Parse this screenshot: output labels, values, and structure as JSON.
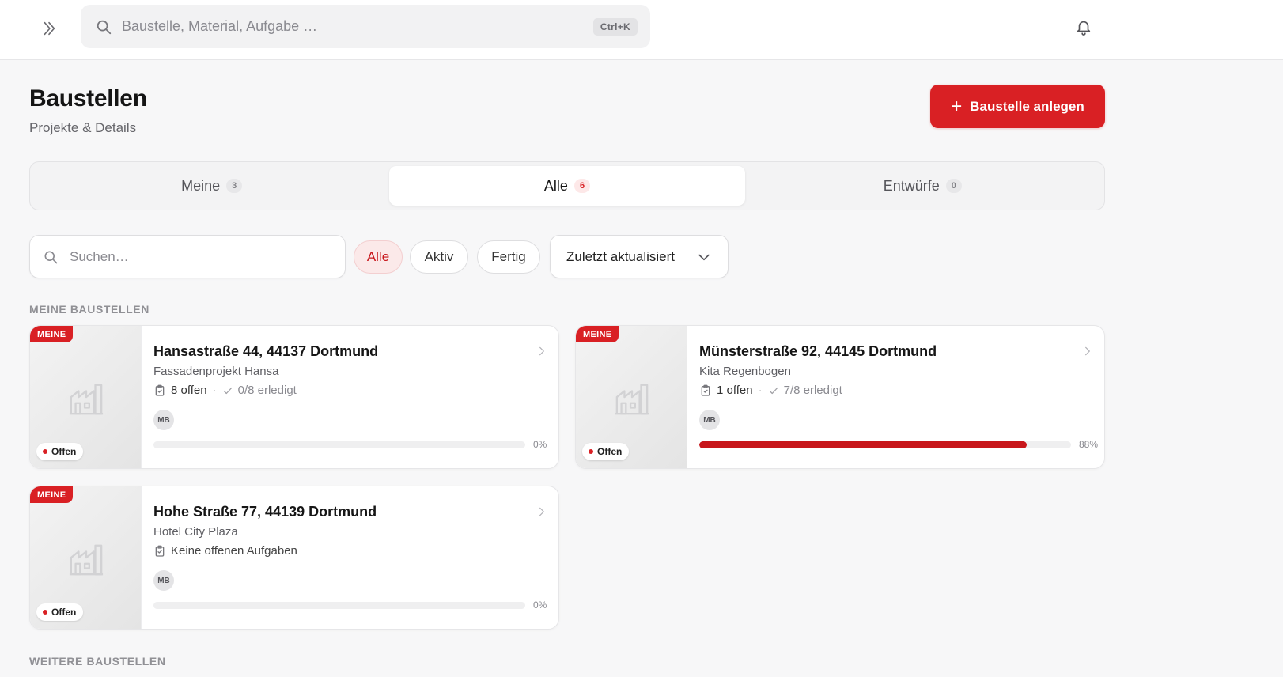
{
  "topbar": {
    "search_placeholder": "Baustelle, Material, Aufgabe …",
    "search_shortcut": "Ctrl+K"
  },
  "header": {
    "title": "Baustellen",
    "subtitle": "Projekte & Details",
    "create_button_label": "Baustelle anlegen"
  },
  "tabs": [
    {
      "label": "Meine",
      "count": "3",
      "active": false
    },
    {
      "label": "Alle",
      "count": "6",
      "active": true
    },
    {
      "label": "Entwürfe",
      "count": "0",
      "active": false
    }
  ],
  "filters": {
    "search_placeholder": "Suchen…",
    "chips": [
      {
        "label": "Alle",
        "active": true
      },
      {
        "label": "Aktiv",
        "active": false
      },
      {
        "label": "Fertig",
        "active": false
      }
    ],
    "sort_value": "Zuletzt aktualisiert"
  },
  "sections": {
    "mine_label": "MEINE BAUSTELLEN",
    "more_label": "WEITERE BAUSTELLEN"
  },
  "cards": [
    {
      "tag": "MEINE",
      "status": "Offen",
      "title": "Hansastraße 44, 44137 Dortmund",
      "project": "Fassadenprojekt Hansa",
      "open_tasks": "8 offen",
      "done_tasks": "0/8 erledigt",
      "avatar": "MB",
      "progress": 0,
      "progress_label": "0%"
    },
    {
      "tag": "MEINE",
      "status": "Offen",
      "title": "Münsterstraße 92, 44145 Dortmund",
      "project": "Kita Regenbogen",
      "open_tasks": "1 offen",
      "done_tasks": "7/8 erledigt",
      "avatar": "MB",
      "progress": 88,
      "progress_label": "88%"
    },
    {
      "tag": "MEINE",
      "status": "Offen",
      "title": "Hohe Straße 77, 44139 Dortmund",
      "project": "Hotel City Plaza",
      "no_tasks": "Keine offenen Aufgaben",
      "avatar": "MB",
      "progress": 0,
      "progress_label": "0%"
    }
  ],
  "colors": {
    "accent": "#d92024",
    "progress": "#c8161b"
  }
}
